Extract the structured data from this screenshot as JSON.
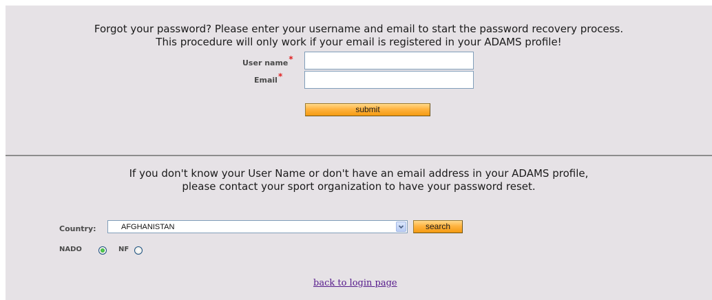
{
  "recovery": {
    "intro_line1": "Forgot your password? Please enter your username and email to start the password recovery process.",
    "intro_line2": "This procedure will only work if your email is registered in your ADAMS profile!",
    "username_label": "User name",
    "email_label": "Email",
    "required_mark": "*",
    "username_value": "",
    "email_value": "",
    "submit_label": "submit"
  },
  "contact": {
    "intro_line1": "If you don't know your User Name or don't have an email address in your ADAMS profile,",
    "intro_line2": "please contact your sport organization to have your password reset.",
    "country_label": "Country:",
    "country_selected": "AFGHANISTAN",
    "search_label": "search",
    "nado_label": "NADO",
    "nf_label": "NF",
    "selected_org": "NADO",
    "back_link": "back to login page"
  },
  "colors": {
    "panel_bg": "#e6e2e6",
    "button_orange": "#f49a12",
    "required": "#e02020",
    "link": "#551a8b"
  }
}
